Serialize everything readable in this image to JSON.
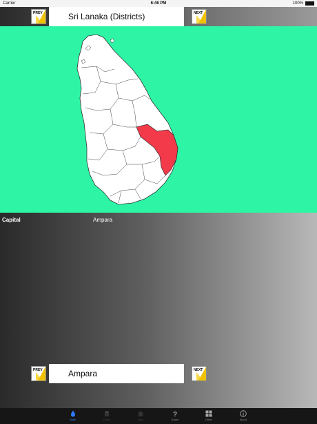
{
  "status_bar": {
    "carrier": "Carrier",
    "time": "6:46 PM",
    "battery": "100%"
  },
  "header": {
    "prev_label": "PREV",
    "next_label": "NEXT",
    "title": "Sri Lanaka (Districts)"
  },
  "map": {
    "highlighted_district": "Ampara",
    "highlight_color": "#f23a4a",
    "background_color": "#2ef5a6"
  },
  "info": {
    "capital_label": "Capital",
    "capital_value": "Ampara"
  },
  "footer": {
    "prev_label": "PREV",
    "next_label": "NEXT",
    "selected_district": "Ampara"
  },
  "tabs": [
    {
      "label": "Main",
      "icon": "drop-icon",
      "active": true
    },
    {
      "label": "Learn",
      "icon": "book-icon",
      "active": false
    },
    {
      "label": "Quiz",
      "icon": "house-icon",
      "active": false
    },
    {
      "label": "Game",
      "icon": "question-icon",
      "active": false
    },
    {
      "label": "Other",
      "icon": "grid-icon",
      "active": false
    },
    {
      "label": "About",
      "icon": "info-icon",
      "active": false
    }
  ]
}
